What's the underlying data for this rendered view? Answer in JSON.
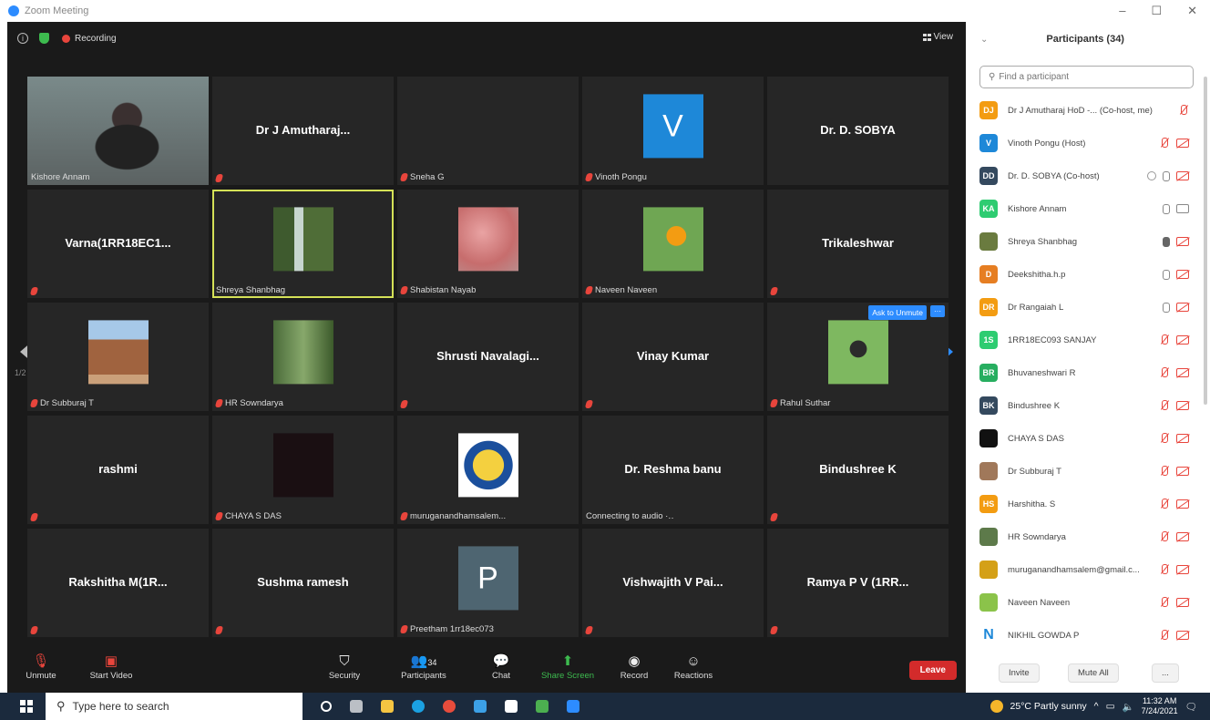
{
  "window": {
    "title": "Zoom Meeting",
    "controls": [
      "–",
      "☐",
      "✕"
    ]
  },
  "meeting": {
    "recording_label": "Recording",
    "view_label": "View",
    "page_left": "1/2",
    "page_right": "1/2"
  },
  "tiles": [
    {
      "name": "Kishore Annam",
      "type": "camera",
      "label": "Kishore Annam",
      "muted": false
    },
    {
      "name": "Dr J Amutharaj...",
      "type": "name",
      "label": "",
      "muted": true
    },
    {
      "name": "",
      "type": "blank",
      "label": "Sneha G",
      "muted": true
    },
    {
      "name": "V",
      "type": "letter",
      "color": "#1e88d8",
      "label": "Vinoth Pongu",
      "muted": true
    },
    {
      "name": "Dr. D. SOBYA",
      "type": "name",
      "label": "",
      "muted": false
    },
    {
      "name": "Varna(1RR18EC1...",
      "type": "name",
      "label": "",
      "muted": true
    },
    {
      "name": "",
      "type": "photo",
      "photo": "waterfall",
      "label": "Shreya Shanbhag",
      "muted": false,
      "active": true
    },
    {
      "name": "",
      "type": "photo",
      "photo": "pink",
      "label": "Shabistan Nayab",
      "muted": true
    },
    {
      "name": "",
      "type": "photo",
      "photo": "butterfly",
      "label": "Naveen Naveen",
      "muted": true
    },
    {
      "name": "Trikaleshwar",
      "type": "name",
      "label": "",
      "muted": true
    },
    {
      "name": "",
      "type": "photo",
      "photo": "temple",
      "label": "Dr Subburaj T",
      "muted": true
    },
    {
      "name": "",
      "type": "photo",
      "photo": "forest",
      "label": "HR Sowndarya",
      "muted": true
    },
    {
      "name": "Shrusti Navalagi...",
      "type": "name",
      "label": "",
      "muted": true
    },
    {
      "name": "Vinay Kumar",
      "type": "name",
      "label": "",
      "muted": true
    },
    {
      "name": "",
      "type": "photo",
      "photo": "person",
      "label": "Rahul Suthar",
      "muted": true,
      "ask_unmute": "Ask to Unmute"
    },
    {
      "name": "rashmi",
      "type": "name",
      "label": "",
      "muted": true
    },
    {
      "name": "",
      "type": "photo",
      "photo": "dark",
      "label": "CHAYA S DAS",
      "muted": true
    },
    {
      "name": "",
      "type": "photo",
      "photo": "logo",
      "label": "muruganandhamsalem...",
      "muted": true
    },
    {
      "name": "Dr. Reshma banu",
      "type": "name",
      "label": "Connecting to audio ·‥",
      "muted": false
    },
    {
      "name": "Bindushree K",
      "type": "name",
      "label": "",
      "muted": true
    },
    {
      "name": "Rakshitha M(1R...",
      "type": "name",
      "label": "",
      "muted": true
    },
    {
      "name": "Sushma ramesh",
      "type": "name",
      "label": "",
      "muted": true
    },
    {
      "name": "P",
      "type": "letter",
      "color": "#4e6571",
      "label": "Preetham 1rr18ec073",
      "muted": true
    },
    {
      "name": "Vishwajith V Pai...",
      "type": "name",
      "label": "",
      "muted": true
    },
    {
      "name": "Ramya P V (1RR...",
      "type": "name",
      "label": "",
      "muted": true
    }
  ],
  "toolbar": {
    "unmute": "Unmute",
    "start_video": "Start Video",
    "security": "Security",
    "participants": "Participants",
    "participants_count": "34",
    "chat": "Chat",
    "share_screen": "Share Screen",
    "record": "Record",
    "reactions": "Reactions",
    "leave": "Leave"
  },
  "participants_panel": {
    "title": "Participants (34)",
    "search_placeholder": "Find a participant",
    "items": [
      {
        "initials": "DJ",
        "color": "#f39c12",
        "name": "Dr J Amutharaj HoD -... (Co-host, me)",
        "mic": "off",
        "cam": ""
      },
      {
        "initials": "V",
        "color": "#1e88d8",
        "name": "Vinoth Pongu (Host)",
        "mic": "off",
        "cam": "off"
      },
      {
        "initials": "DD",
        "color": "#34495e",
        "name": "Dr. D. SOBYA (Co-host)",
        "mic": "on",
        "cam": "off",
        "screen": true
      },
      {
        "initials": "KA",
        "color": "#2ecc71",
        "name": "Kishore Annam",
        "mic": "on",
        "cam": "on"
      },
      {
        "initials": "",
        "color": "#6a7b3f",
        "name": "Shreya Shanbhag",
        "mic": "active",
        "cam": "off"
      },
      {
        "initials": "D",
        "color": "#e67e22",
        "name": "Deekshitha.h.p",
        "mic": "on",
        "cam": "off"
      },
      {
        "initials": "DR",
        "color": "#f39c12",
        "name": "Dr Rangaiah L",
        "mic": "on",
        "cam": "off"
      },
      {
        "initials": "1S",
        "color": "#2ecc71",
        "name": "1RR18EC093 SANJAY",
        "mic": "off",
        "cam": "off"
      },
      {
        "initials": "BR",
        "color": "#27ae60",
        "name": "Bhuvaneshwari R",
        "mic": "off",
        "cam": "off"
      },
      {
        "initials": "BK",
        "color": "#34495e",
        "name": "Bindushree K",
        "mic": "off",
        "cam": "off"
      },
      {
        "initials": "",
        "color": "#111111",
        "name": "CHAYA S DAS",
        "mic": "off",
        "cam": "off"
      },
      {
        "initials": "",
        "color": "#a0785a",
        "name": "Dr Subburaj T",
        "mic": "off",
        "cam": "off"
      },
      {
        "initials": "HS",
        "color": "#f39c12",
        "name": "Harshitha. S",
        "mic": "off",
        "cam": "off"
      },
      {
        "initials": "",
        "color": "#5d7a4a",
        "name": "HR Sowndarya",
        "mic": "off",
        "cam": "off"
      },
      {
        "initials": "",
        "color": "#d4a017",
        "name": "muruganandhamsalem@gmail.c...",
        "mic": "off",
        "cam": "off"
      },
      {
        "initials": "",
        "color": "#8bc34a",
        "name": "Naveen Naveen",
        "mic": "off",
        "cam": "off"
      },
      {
        "initials": "N",
        "color": "#ffffff",
        "name": "NIKHIL GOWDA P",
        "mic": "off",
        "cam": "off"
      }
    ],
    "invite": "Invite",
    "mute_all": "Mute All",
    "more": "..."
  },
  "taskbar": {
    "search_placeholder": "Type here to search",
    "weather": "25°C  Partly sunny",
    "time": "11:32 AM",
    "date": "7/24/2021"
  }
}
